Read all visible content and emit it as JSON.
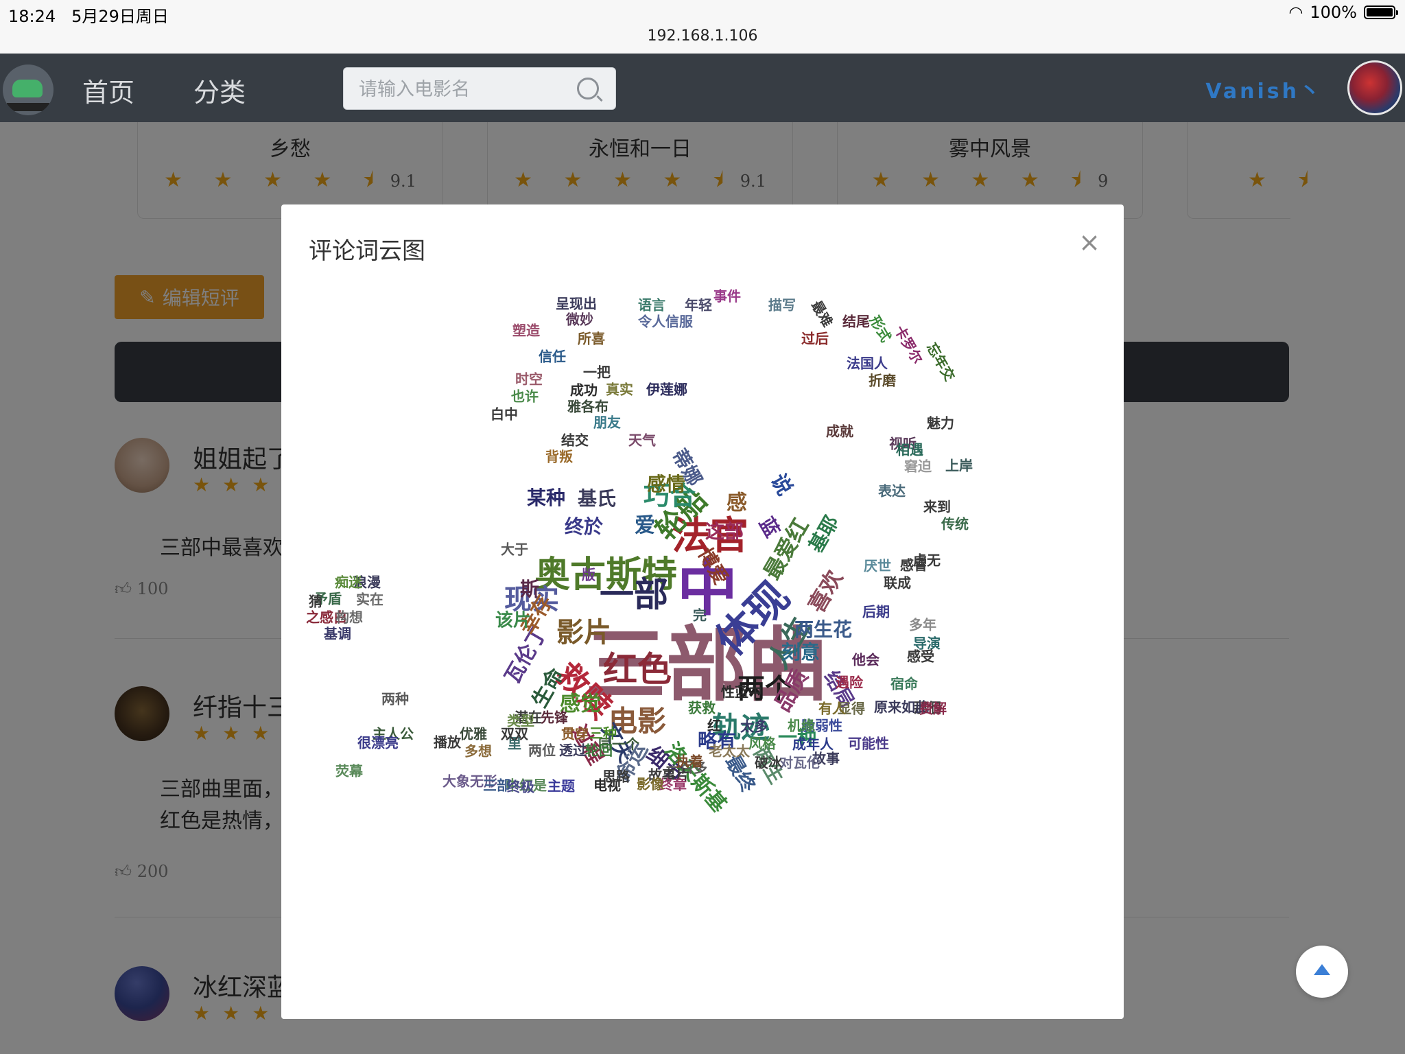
{
  "status": {
    "time": "18:24",
    "date": "5月29日周日",
    "battery": "100%"
  },
  "browser": {
    "url": "192.168.1.106"
  },
  "nav": {
    "links": [
      "首页",
      "分类"
    ],
    "search_placeholder": "请输入电影名",
    "username": "Vanish丶"
  },
  "movies": [
    {
      "title": "乡愁",
      "stars": "★ ★ ★ ★ ⯨",
      "score": "9.1"
    },
    {
      "title": "永恒和一日",
      "stars": "★ ★ ★ ★ ⯨",
      "score": "9.1"
    },
    {
      "title": "雾中风景",
      "stars": "★ ★ ★ ★ ⯨",
      "score": "9"
    },
    {
      "title": "",
      "stars": "★ ⯨",
      "score": ""
    }
  ],
  "edit_review_label": "编辑短评",
  "comments": [
    {
      "name": "姐姐起了",
      "stars": "★★★",
      "text": "三部中最喜欢",
      "likes": "100"
    },
    {
      "name": "纤指十三",
      "stars": "★★★",
      "text": "三部曲里面，",
      "text2": "红色是热情，",
      "likes": "200"
    },
    {
      "name": "冰红深蓝",
      "stars": "★★★",
      "likes": ""
    }
  ],
  "modal": {
    "title": "评论词云图",
    "close": "×"
  },
  "icons": {
    "edit": "edit-icon",
    "like": "thumbs-up-icon",
    "search": "search-icon",
    "close": "close-icon",
    "back_to_top": "arrow-up-icon"
  },
  "colors": {
    "accent_orange": "#f0a12a",
    "nav_bg": "#373d44",
    "star": "#f2a918",
    "username": "#2f78c4"
  },
  "wordcloud": [
    {
      "t": "三部曲",
      "s": 118,
      "c": "#8d5a6d"
    },
    {
      "t": "中",
      "s": 88,
      "c": "#6b2ea0"
    },
    {
      "t": "奥古斯特",
      "s": 52,
      "c": "#4f7a2a"
    },
    {
      "t": "法官",
      "s": 56,
      "c": "#a3222a"
    },
    {
      "t": "体现",
      "s": 60,
      "c": "#3a3e94"
    },
    {
      "t": "一部",
      "s": 50,
      "c": "#2a2a5a"
    },
    {
      "t": "红色",
      "s": 50,
      "c": "#8b2a38"
    },
    {
      "t": "救赎",
      "s": 46,
      "c": "#b4283a"
    },
    {
      "t": "轮船",
      "s": 42,
      "c": "#3e7a2a"
    },
    {
      "t": "现实",
      "s": 40,
      "c": "#555c9e"
    },
    {
      "t": "电影",
      "s": 42,
      "c": "#8a5a3a"
    },
    {
      "t": "轨迹",
      "s": 42,
      "c": "#2a7a6a"
    },
    {
      "t": "两个",
      "s": 40,
      "c": "#1a1a1a"
    },
    {
      "t": "影片",
      "s": 40,
      "c": "#7a5a2a"
    },
    {
      "t": "巧合",
      "s": 38,
      "c": "#2a8a6a"
    },
    {
      "t": "人生",
      "s": 40,
      "c": "#3a6a5a"
    },
    {
      "t": "最爱红",
      "s": 32,
      "c": "#4a7a3a"
    },
    {
      "t": "喜欢",
      "s": 32,
      "c": "#8a4a5a"
    },
    {
      "t": "品质",
      "s": 32,
      "c": "#8a3a6a"
    },
    {
      "t": "两生花",
      "s": 28,
      "c": "#3a5a8a"
    },
    {
      "t": "刻意",
      "s": 28,
      "c": "#2a6a8a"
    },
    {
      "t": "瓦伦丁",
      "s": 30,
      "c": "#5a3a8a"
    },
    {
      "t": "幸存",
      "s": 30,
      "c": "#9a5a2a"
    },
    {
      "t": "生命",
      "s": 30,
      "c": "#2a5a3a"
    },
    {
      "t": "感觉",
      "s": 30,
      "c": "#4a8a2a"
    },
    {
      "t": "过程",
      "s": 30,
      "c": "#8a2a4a"
    },
    {
      "t": "文夫",
      "s": 30,
      "c": "#2a3a6a"
    },
    {
      "t": "命运",
      "s": 30,
      "c": "#5a6a8a"
    },
    {
      "t": "细节",
      "s": 30,
      "c": "#3a2a6a"
    },
    {
      "t": "洛夫斯基",
      "s": 30,
      "c": "#3a8a3a"
    },
    {
      "t": "略有",
      "s": 28,
      "c": "#2a3a8a"
    },
    {
      "t": "两生",
      "s": 28,
      "c": "#5a8a6a"
    },
    {
      "t": "一种",
      "s": 28,
      "c": "#2a8a5a"
    },
    {
      "t": "结局",
      "s": 28,
      "c": "#5a3a8a"
    },
    {
      "t": "最终",
      "s": 28,
      "c": "#3a5a8a"
    },
    {
      "t": "这部",
      "s": 28,
      "c": "#9a2a5a"
    },
    {
      "t": "感",
      "s": 30,
      "c": "#8a5a2a"
    },
    {
      "t": "爱",
      "s": 30,
      "c": "#2a5a8a"
    },
    {
      "t": "终於",
      "s": 28,
      "c": "#3a3a8a"
    },
    {
      "t": "某种",
      "s": 28,
      "c": "#2a2a6a"
    },
    {
      "t": "基氏",
      "s": 28,
      "c": "#3a3a5a"
    },
    {
      "t": "感情",
      "s": 28,
      "c": "#6a6a1a"
    },
    {
      "t": "蒂娜",
      "s": 28,
      "c": "#4a5a8a"
    },
    {
      "t": "博爱",
      "s": 28,
      "c": "#8a3a2a"
    },
    {
      "t": "蓝",
      "s": 28,
      "c": "#5a2a8a"
    },
    {
      "t": "说",
      "s": 30,
      "c": "#2a4a9a"
    },
    {
      "t": "基耶",
      "s": 28,
      "c": "#2a7a4a"
    },
    {
      "t": "该片",
      "s": 26,
      "c": "#3a8a4a"
    },
    {
      "t": "斯",
      "s": 28,
      "c": "#5a2a4a"
    },
    {
      "t": "呈现出",
      "s": 20,
      "c": "#3a3a5a"
    },
    {
      "t": "语言",
      "s": 20,
      "c": "#3a7a6a"
    },
    {
      "t": "年轻",
      "s": 20,
      "c": "#4a4a6a"
    },
    {
      "t": "事件",
      "s": 20,
      "c": "#9a3a8a"
    },
    {
      "t": "描写",
      "s": 20,
      "c": "#5a7a8a"
    },
    {
      "t": "最难",
      "s": 20,
      "c": "#3a3a3a"
    },
    {
      "t": "结尾",
      "s": 20,
      "c": "#5a2a3a"
    },
    {
      "t": "形式",
      "s": 20,
      "c": "#3a8a3a"
    },
    {
      "t": "卡罗尔",
      "s": 20,
      "c": "#8a2a6a"
    },
    {
      "t": "忘年交",
      "s": 20,
      "c": "#3a6a2a"
    },
    {
      "t": "微妙",
      "s": 20,
      "c": "#5a3a5a"
    },
    {
      "t": "令人信服",
      "s": 20,
      "c": "#5a6a9a"
    },
    {
      "t": "塑造",
      "s": 20,
      "c": "#9a4a6a"
    },
    {
      "t": "所喜",
      "s": 20,
      "c": "#7a5a2a"
    },
    {
      "t": "过后",
      "s": 20,
      "c": "#8a2a2a"
    },
    {
      "t": "法国人",
      "s": 20,
      "c": "#3a3a8a"
    },
    {
      "t": "折磨",
      "s": 20,
      "c": "#5a4a2a"
    },
    {
      "t": "信任",
      "s": 20,
      "c": "#2a5a8a"
    },
    {
      "t": "一把",
      "s": 20,
      "c": "#3a3a3a"
    },
    {
      "t": "成功",
      "s": 20,
      "c": "#2a2a2a"
    },
    {
      "t": "真实",
      "s": 20,
      "c": "#7a7a3a"
    },
    {
      "t": "伊莲娜",
      "s": 20,
      "c": "#2a2a5a"
    },
    {
      "t": "时空",
      "s": 20,
      "c": "#9a5a6a"
    },
    {
      "t": "也许",
      "s": 20,
      "c": "#4a8a4a"
    },
    {
      "t": "白中",
      "s": 20,
      "c": "#3a3a3a"
    },
    {
      "t": "雅各布",
      "s": 20,
      "c": "#3a4a3a"
    },
    {
      "t": "成就",
      "s": 20,
      "c": "#5a3a3a"
    },
    {
      "t": "魅力",
      "s": 20,
      "c": "#3a3a3a"
    },
    {
      "t": "视听",
      "s": 20,
      "c": "#5a3a5a"
    },
    {
      "t": "朋友",
      "s": 20,
      "c": "#3a7a8a"
    },
    {
      "t": "天气",
      "s": 20,
      "c": "#7a4a6a"
    },
    {
      "t": "结交",
      "s": 20,
      "c": "#3a3a3a"
    },
    {
      "t": "相遇",
      "s": 20,
      "c": "#2a6a5a"
    },
    {
      "t": "窘迫",
      "s": 20,
      "c": "#9a9a9a"
    },
    {
      "t": "上岸",
      "s": 20,
      "c": "#3a5a5a"
    },
    {
      "t": "表达",
      "s": 20,
      "c": "#4a6a7a"
    },
    {
      "t": "背叛",
      "s": 20,
      "c": "#9a6a2a"
    },
    {
      "t": "来到",
      "s": 20,
      "c": "#3a3a3a"
    },
    {
      "t": "传统",
      "s": 20,
      "c": "#3a6a4a"
    },
    {
      "t": "大于",
      "s": 20,
      "c": "#5a5a5a"
    },
    {
      "t": "版",
      "s": 20,
      "c": "#6a3a8a"
    },
    {
      "t": "虚无",
      "s": 20,
      "c": "#3a3a3a"
    },
    {
      "t": "厌世",
      "s": 20,
      "c": "#5a8a9a"
    },
    {
      "t": "感冒",
      "s": 20,
      "c": "#3a3a3a"
    },
    {
      "t": "联成",
      "s": 20,
      "c": "#3a3a3a"
    },
    {
      "t": "后期",
      "s": 20,
      "c": "#3a3a8a"
    },
    {
      "t": "多年",
      "s": 20,
      "c": "#8a8a8a"
    },
    {
      "t": "导演",
      "s": 20,
      "c": "#2a6a6a"
    },
    {
      "t": "他会",
      "s": 20,
      "c": "#5a2a5a"
    },
    {
      "t": "感受",
      "s": 20,
      "c": "#3a3a3a"
    },
    {
      "t": "遇险",
      "s": 20,
      "c": "#9a2a4a"
    },
    {
      "t": "宿命",
      "s": 20,
      "c": "#3a7a5a"
    },
    {
      "t": "那個",
      "s": 20,
      "c": "#3a3a3a"
    },
    {
      "t": "原来如此",
      "s": 20,
      "c": "#3a3a5a"
    },
    {
      "t": "显得",
      "s": 20,
      "c": "#6a6a4a"
    },
    {
      "t": "有人",
      "s": 20,
      "c": "#7a6a2a"
    },
    {
      "t": "费解",
      "s": 20,
      "c": "#8a2a4a"
    },
    {
      "t": "脆弱性",
      "s": 20,
      "c": "#3a4a9a"
    },
    {
      "t": "机缘",
      "s": 20,
      "c": "#4a8a4a"
    },
    {
      "t": "太多",
      "s": 20,
      "c": "#3a3a6a"
    },
    {
      "t": "成年人",
      "s": 20,
      "c": "#2a3a8a"
    },
    {
      "t": "故事",
      "s": 20,
      "c": "#3a3a5a"
    },
    {
      "t": "可能性",
      "s": 20,
      "c": "#4a3a8a"
    },
    {
      "t": "对瓦伦",
      "s": 20,
      "c": "#6a6a8a"
    },
    {
      "t": "破冰",
      "s": 20,
      "c": "#3a3a3a"
    },
    {
      "t": "性蓝中",
      "s": 20,
      "c": "#2a2a2a"
    },
    {
      "t": "获救",
      "s": 20,
      "c": "#3a7a3a"
    },
    {
      "t": "红",
      "s": 20,
      "c": "#2a2a2a"
    },
    {
      "t": "风格",
      "s": 20,
      "c": "#4a8a4a"
    },
    {
      "t": "老太太",
      "s": 20,
      "c": "#8a7a5a"
    },
    {
      "t": "一百多",
      "s": 20,
      "c": "#5a5a5a"
    },
    {
      "t": "执着",
      "s": 20,
      "c": "#7a4a2a"
    },
    {
      "t": "故事片",
      "s": 20,
      "c": "#3a3a3a"
    },
    {
      "t": "同一个",
      "s": 20,
      "c": "#3a5a3a"
    },
    {
      "t": "终章",
      "s": 20,
      "c": "#9a3a6a"
    },
    {
      "t": "影像",
      "s": 20,
      "c": "#7a6a2a"
    },
    {
      "t": "电视",
      "s": 20,
      "c": "#2a2a2a"
    },
    {
      "t": "思路",
      "s": 20,
      "c": "#3a3a3a"
    },
    {
      "t": "中红是",
      "s": 20,
      "c": "#5a8a5a"
    },
    {
      "t": "主题",
      "s": 20,
      "c": "#3a3a9a"
    },
    {
      "t": "终极",
      "s": 20,
      "c": "#4a4a8a"
    },
    {
      "t": "大象无形",
      "s": 20,
      "c": "#6a5a8a"
    },
    {
      "t": "三部",
      "s": 20,
      "c": "#3a5a8a"
    },
    {
      "t": "里",
      "s": 20,
      "c": "#3a6a6a"
    },
    {
      "t": "两位",
      "s": 20,
      "c": "#5a5a5a"
    },
    {
      "t": "透过",
      "s": 20,
      "c": "#3a3a5a"
    },
    {
      "t": "轮回",
      "s": 20,
      "c": "#3a7a3a"
    },
    {
      "t": "多想",
      "s": 20,
      "c": "#8a6a3a"
    },
    {
      "t": "双双",
      "s": 20,
      "c": "#3a3a3a"
    },
    {
      "t": "贯穿",
      "s": 20,
      "c": "#8a5a2a"
    },
    {
      "t": "三种",
      "s": 20,
      "c": "#4a8a2a"
    },
    {
      "t": "优雅",
      "s": 20,
      "c": "#3a4a3a"
    },
    {
      "t": "潜在",
      "s": 20,
      "c": "#3a3a3a"
    },
    {
      "t": "先锋",
      "s": 20,
      "c": "#5a2a3a"
    },
    {
      "t": "类型",
      "s": 20,
      "c": "#6a8a4a"
    },
    {
      "t": "主人公",
      "s": 20,
      "c": "#3a5a3a"
    },
    {
      "t": "很漂亮",
      "s": 20,
      "c": "#3a3a8a"
    },
    {
      "t": "播放",
      "s": 20,
      "c": "#3a3a3a"
    },
    {
      "t": "两种",
      "s": 20,
      "c": "#5a5a5a"
    },
    {
      "t": "荧幕",
      "s": 20,
      "c": "#5a8a5a"
    },
    {
      "t": "之感白",
      "s": 20,
      "c": "#8a2a3a"
    },
    {
      "t": "构想",
      "s": 20,
      "c": "#6a6a6a"
    },
    {
      "t": "基调",
      "s": 20,
      "c": "#3a3a6a"
    },
    {
      "t": "浪漫",
      "s": 20,
      "c": "#3a3a5a"
    },
    {
      "t": "实在",
      "s": 20,
      "c": "#6a6a6a"
    },
    {
      "t": "矛盾",
      "s": 20,
      "c": "#3a6a4a"
    },
    {
      "t": "痴迷",
      "s": 20,
      "c": "#5a8a3a"
    },
    {
      "t": "猜",
      "s": 20,
      "c": "#3a3a3a"
    },
    {
      "t": "完",
      "s": 20,
      "c": "#3a5a5a"
    }
  ]
}
